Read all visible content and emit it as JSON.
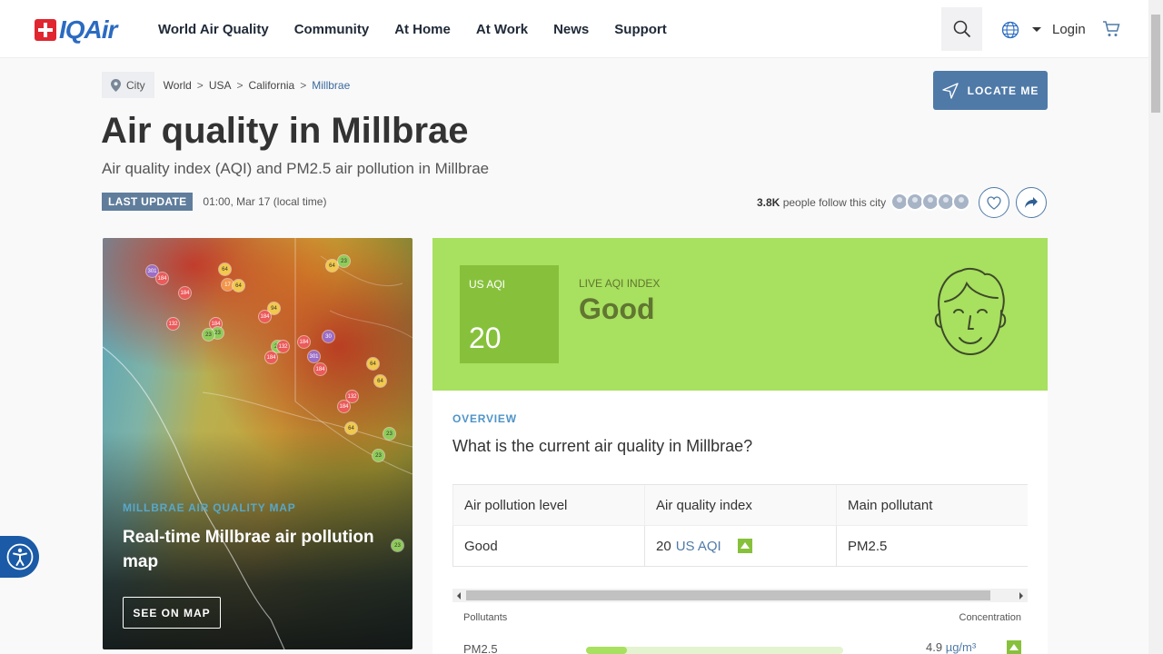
{
  "nav": {
    "logo_text": "IQAir",
    "menu": [
      "World Air Quality",
      "Community",
      "At Home",
      "At Work",
      "News",
      "Support"
    ],
    "login": "Login"
  },
  "breadcrumb": {
    "tag": "City",
    "items": [
      "World",
      "USA",
      "California",
      "Millbrae"
    ]
  },
  "locate_label": "LOCATE ME",
  "title": "Air quality in Millbrae",
  "subtitle": "Air quality index (AQI) and PM2.5 air pollution in Millbrae",
  "last_update": {
    "badge": "LAST UPDATE",
    "time": "01:00, Mar 17 (local time)"
  },
  "follow": {
    "count": "3.8K",
    "text": "people follow this city"
  },
  "map": {
    "kicker": "MILLBRAE AIR QUALITY MAP",
    "heading": "Real-time Millbrae air pollution map",
    "button": "SEE ON MAP",
    "markers": [
      "301",
      "184",
      "184",
      "64",
      "17",
      "64",
      "64",
      "23",
      "132",
      "94",
      "184",
      "184",
      "23",
      "23",
      "23",
      "30",
      "184",
      "132",
      "184",
      "301",
      "184",
      "64",
      "132",
      "64",
      "184",
      "64",
      "23",
      "23",
      "23"
    ]
  },
  "aqi": {
    "label": "US AQI",
    "value": "20",
    "live_label": "LIVE AQI INDEX",
    "status": "Good",
    "color": "#a8e05f"
  },
  "overview": {
    "kicker": "OVERVIEW",
    "question": "What is the current air quality in Millbrae?",
    "headers": [
      "Air pollution level",
      "Air quality index",
      "Main pollutant"
    ],
    "level": "Good",
    "index_value": "20",
    "index_unit": "US AQI",
    "pollutant": "PM2.5"
  },
  "pollutants": {
    "col_pollutants": "Pollutants",
    "col_concentration": "Concentration",
    "rows": [
      {
        "name": "PM2.5",
        "value": "4.9",
        "unit": "µg/m³",
        "level_fraction": 0.16
      }
    ]
  }
}
